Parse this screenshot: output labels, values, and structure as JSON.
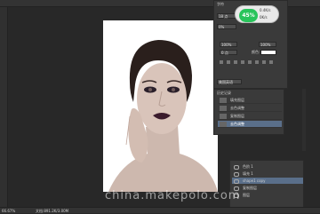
{
  "status": {
    "zoom": "66.67%",
    "doc_info": "文档:891.2K/3.00M"
  },
  "character_panel": {
    "tab": "字符",
    "font_size": "18 点",
    "leading": "0 点",
    "tracking": "0%",
    "scale_v": "100%",
    "scale_h": "100%",
    "baseline": "0 点",
    "color_label": "颜色:",
    "language": "美国英语"
  },
  "hint": {
    "value": "45%",
    "up": "0.4K/s",
    "down": "0K/s"
  },
  "history": {
    "title": "历史记录",
    "items": [
      "填充图层",
      "去色调整",
      "复制图层",
      "去色调整"
    ],
    "selected_index": 3
  },
  "layers": {
    "items": [
      "色阶 1",
      "填充 1",
      "shape1 copy",
      "复制图层",
      "图层"
    ]
  },
  "watermark": "china.makepolo.com"
}
